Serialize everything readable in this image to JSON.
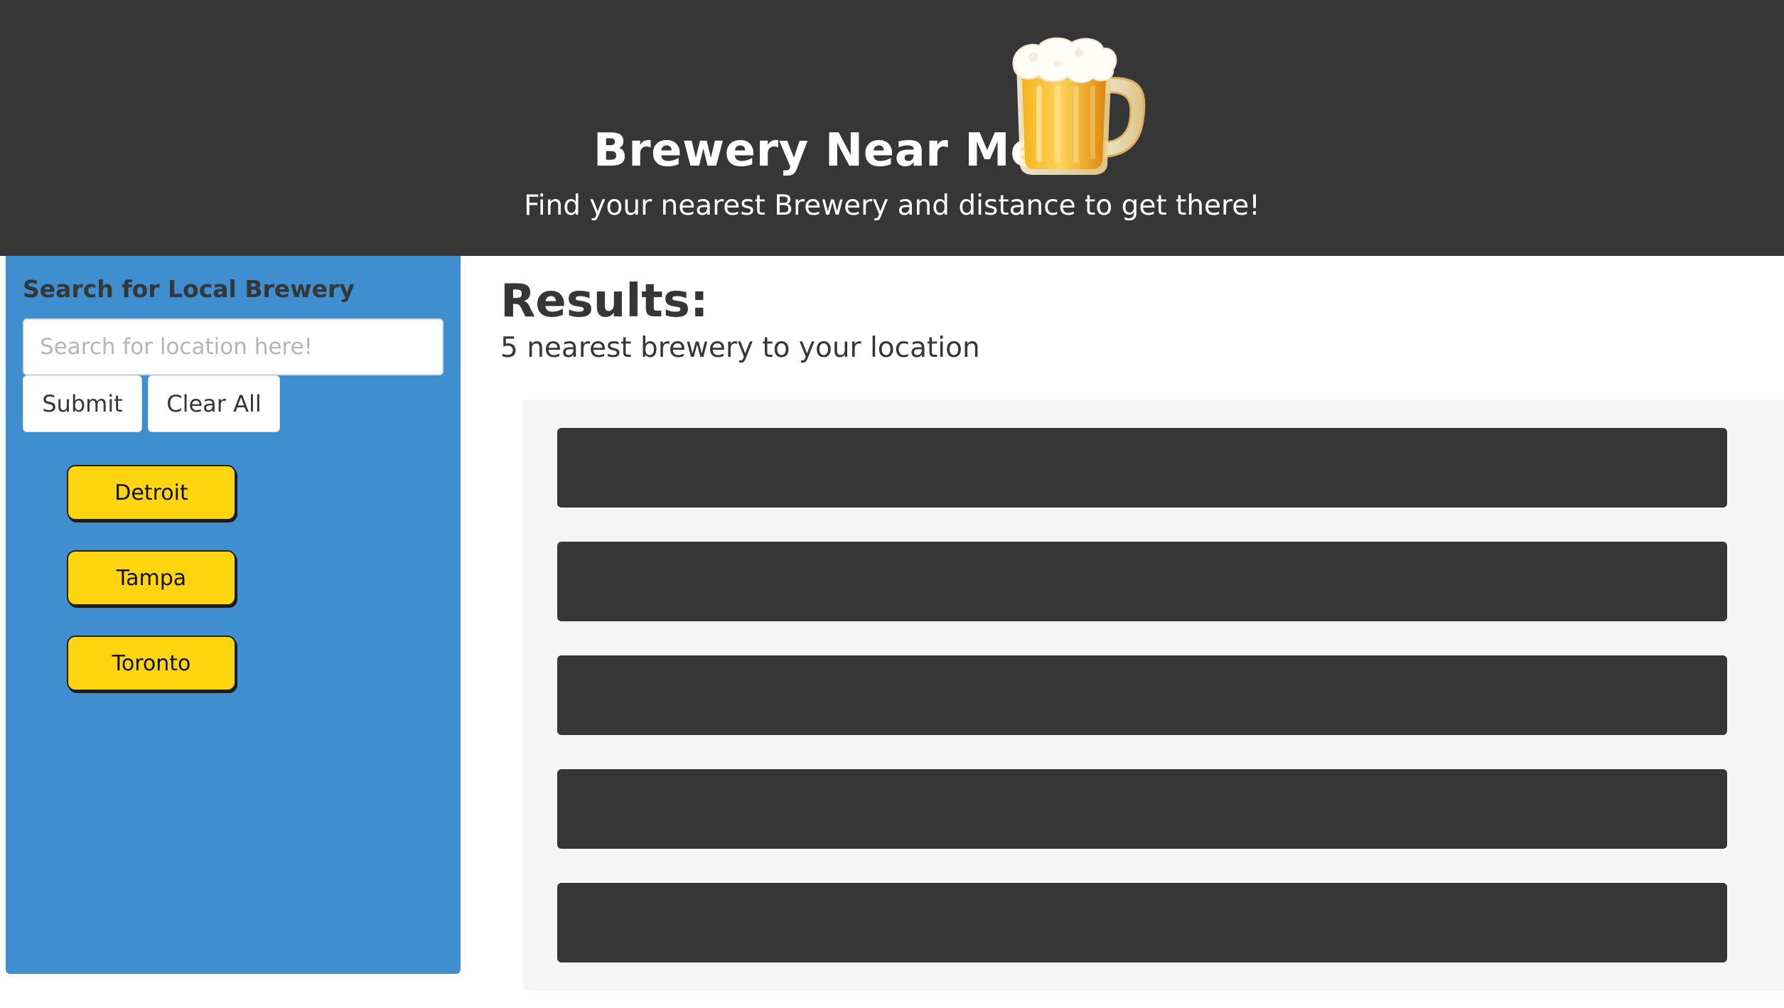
{
  "header": {
    "title": "Brewery Near Me",
    "subtitle": "Find your nearest Brewery and distance to get there!",
    "logo_icon": "beer-mug-icon"
  },
  "sidebar": {
    "heading": "Search for Local Brewery",
    "search": {
      "placeholder": "Search for location here!",
      "value": ""
    },
    "submit_label": "Submit",
    "clear_label": "Clear All",
    "cities": [
      "Detroit",
      "Tampa",
      "Toronto"
    ]
  },
  "results": {
    "title": "Results:",
    "subtitle": "5 nearest brewery to your location",
    "items": [
      "",
      "",
      "",
      "",
      ""
    ]
  },
  "colors": {
    "header_bg": "#363636",
    "sidebar_bg": "#3e8ed0",
    "city_button": "#ffd50f",
    "results_panel": "#f5f5f5",
    "result_item": "#363636"
  }
}
